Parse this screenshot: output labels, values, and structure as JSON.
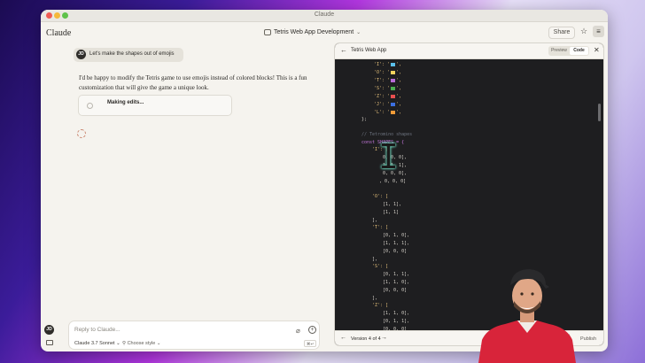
{
  "window": {
    "title": "Claude"
  },
  "app": {
    "name": "Claude",
    "conversation_title": "Tetris Web App Development",
    "share_label": "Share",
    "star_icon": "star-icon",
    "settings_icon": "sliders-icon"
  },
  "chat": {
    "user_initials": "JD",
    "user_message": "Let's make the shapes out of emojis",
    "assistant_message": "I'd be happy to modify the Tetris game to use emojis instead of colored blocks! This is a fun customization that will give the game a unique look.",
    "edit_status": "Making edits..."
  },
  "composer": {
    "placeholder": "Reply to Claude...",
    "model": "Claude 3.7 Sonnet",
    "style": "Choose style",
    "shortcut": "⌘↵"
  },
  "artifact": {
    "title": "Tetris Web App",
    "tabs": {
      "preview": "Preview",
      "code": "Code"
    },
    "active_tab": "Code",
    "version_label": "Version 4 of 4",
    "publish_label": "Publish",
    "colors": {
      "I": "#5bc0eb",
      "O": "#f4d35e",
      "T": "#b86bd6",
      "S": "#4caf50",
      "Z": "#e94f4f",
      "J": "#3b6fe0",
      "L": "#f29b38"
    },
    "code_lines": [
      "'I': '",
      "'O': '",
      "'T': '",
      "'S': '",
      "'Z': '",
      "'J': '",
      "'L': '",
      "};",
      "// Tetromino shapes",
      "const SHAPES = {",
      "'I': [",
      "0, 0, 0],",
      "1, 1, 1],",
      "0, 0, 0],",
      ", 0, 0, 0]",
      "'O': [",
      "[1, 1],",
      "[1, 1]",
      "],",
      "'T': [",
      "[0, 1, 0],",
      "[1, 1, 1],",
      "[0, 0, 0]",
      "],",
      "'S': [",
      "[0, 1, 1],",
      "[1, 1, 0],",
      "[0, 0, 0]",
      "],",
      "'Z': [",
      "[1, 1, 0],",
      "[0, 1, 1],",
      "[0, 0, 0]"
    ]
  }
}
